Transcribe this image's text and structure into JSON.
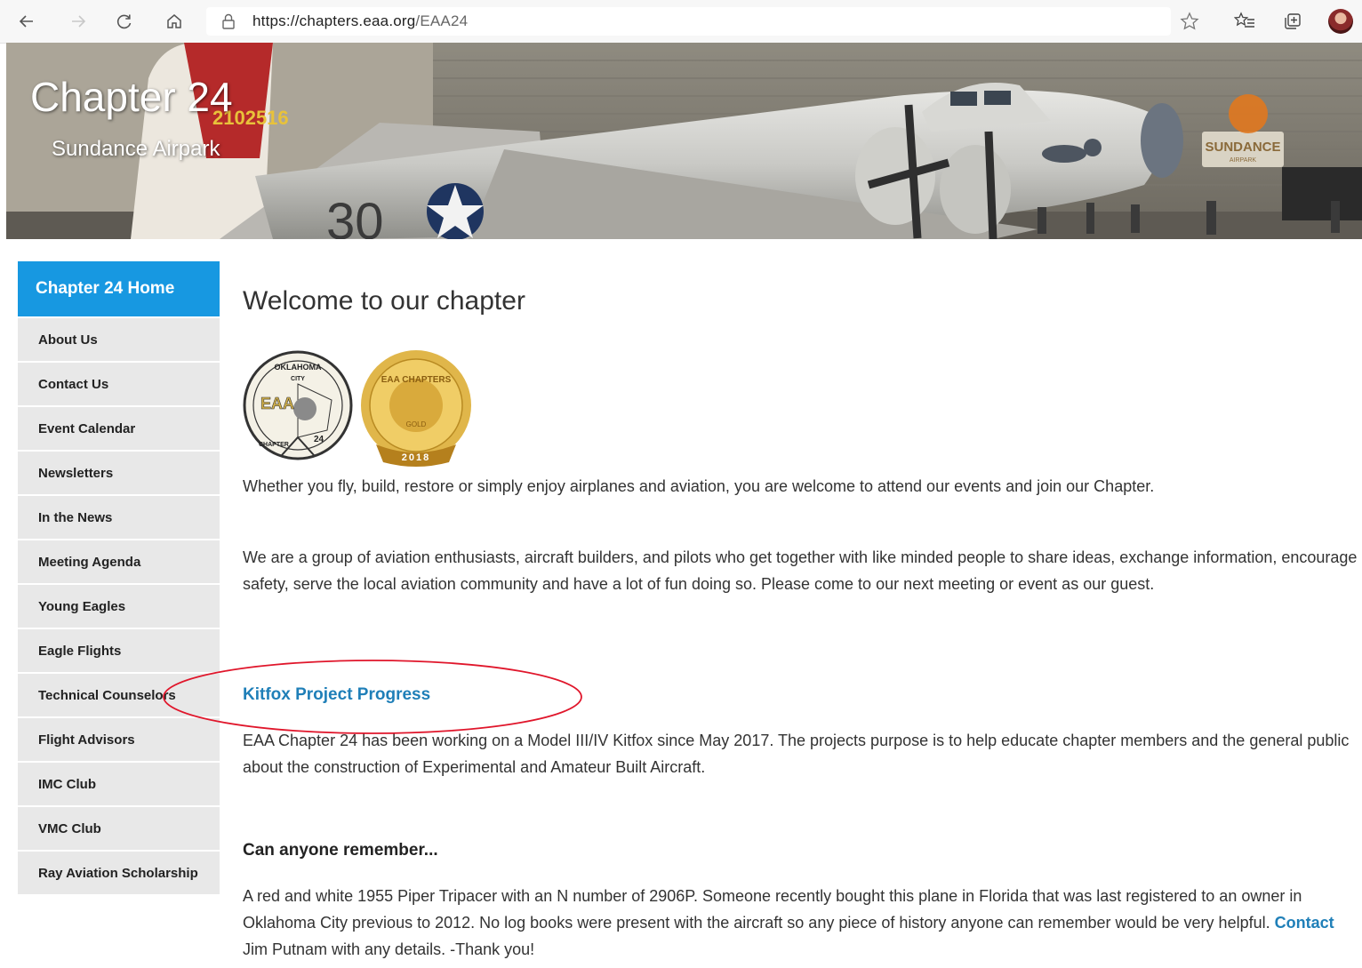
{
  "browser": {
    "url_host": "https://chapters.eaa.org",
    "url_path": "/EAA24",
    "icons": [
      "back-arrow-icon",
      "forward-arrow-icon",
      "refresh-icon",
      "home-icon",
      "lock-icon",
      "star-icon",
      "favorites-icon",
      "collections-icon",
      "profile-avatar"
    ]
  },
  "banner": {
    "title": "Chapter 24",
    "subtitle": "Sundance Airpark",
    "tail_marking": "2102516",
    "fuselage_number": "30",
    "hangar_sign": "SUNDANCE",
    "hangar_sign_sub": "AIRPARK"
  },
  "sidebar": {
    "home_label": "Chapter 24 Home",
    "items": [
      {
        "label": "About Us"
      },
      {
        "label": "Contact Us"
      },
      {
        "label": "Event Calendar"
      },
      {
        "label": "Newsletters"
      },
      {
        "label": "In the News"
      },
      {
        "label": "Meeting Agenda"
      },
      {
        "label": "Young Eagles"
      },
      {
        "label": "Eagle Flights"
      },
      {
        "label": "Technical Counselors"
      },
      {
        "label": "Flight Advisors"
      },
      {
        "label": "IMC Club"
      },
      {
        "label": "VMC Club"
      },
      {
        "label": "Ray Aviation Scholarship"
      }
    ]
  },
  "main": {
    "title": "Welcome to our chapter",
    "logo1": {
      "top": "OKLAHOMA",
      "mid": "CITY",
      "letters": "EAA",
      "side": "CHAPTER",
      "num": "24"
    },
    "logo2": {
      "top": "EAA CHAPTERS",
      "mid": "GOLD",
      "year": "2018"
    },
    "intro": "Whether you fly, build, restore or simply enjoy airplanes and aviation, you are welcome to attend our events and join our Chapter.",
    "about": "We are a group of aviation enthusiasts, aircraft builders, and pilots who get together with like minded people to share ideas, exchange information, encourage safety, serve the local aviation community and have a lot of fun doing so. Please come to our next meeting or event as our guest.",
    "kitfox_link": "Kitfox Project Progress",
    "kitfox_text": "EAA Chapter 24 has been working on a Model III/IV Kitfox since May 2017. The projects purpose is to help educate chapter members and the general public about the construction of Experimental and Amateur Built Aircraft.",
    "remember_heading": "Can anyone remember...",
    "remember_text_a": "A red and white 1955 Piper Tripacer with an N number of 2906P. Someone recently bought this plane in Florida that was last registered to an owner in Oklahoma City previous to 2012. No log books were present with the aircraft so any piece of history anyone can remember would be very helpful.",
    "remember_link": "Contact",
    "remember_text_b": " Jim Putnam with any details. -Thank you!"
  },
  "colors": {
    "accent": "#1798e1",
    "link": "#1f7fb8",
    "sidebar_bg": "#e8e8e8",
    "annotation": "#e0162b"
  }
}
